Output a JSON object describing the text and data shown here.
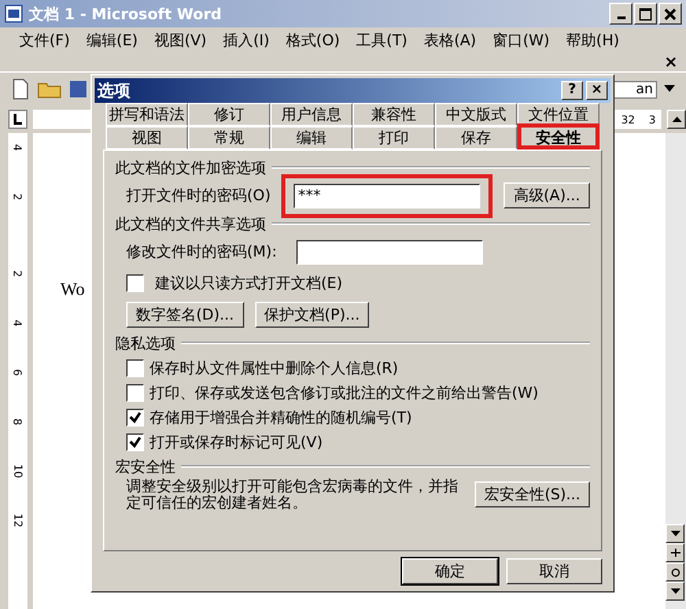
{
  "window": {
    "title": "文档 1 - Microsoft Word"
  },
  "menu": [
    "文件(F)",
    "编辑(E)",
    "视图(V)",
    "插入(I)",
    "格式(O)",
    "工具(T)",
    "表格(A)",
    "窗口(W)",
    "帮助(H)"
  ],
  "menu_close": "×",
  "toolbar": {
    "font_field": "an"
  },
  "ruler": [
    "32",
    "3"
  ],
  "vertical_ruler": [
    "4",
    "2",
    "2",
    "4",
    "6",
    "8",
    "10",
    "12"
  ],
  "document": {
    "text": "Wo"
  },
  "dialog": {
    "title": "选项",
    "help": "?",
    "close": "×",
    "tabs_back": [
      {
        "label": "拼写和语法",
        "selected": false
      },
      {
        "label": "修订",
        "selected": false
      },
      {
        "label": "用户信息",
        "selected": false
      },
      {
        "label": "兼容性",
        "selected": false
      },
      {
        "label": "中文版式",
        "selected": false
      },
      {
        "label": "文件位置",
        "selected": false
      }
    ],
    "tabs_front": [
      {
        "label": "视图",
        "selected": false,
        "highlighted": false
      },
      {
        "label": "常规",
        "selected": false,
        "highlighted": false
      },
      {
        "label": "编辑",
        "selected": false,
        "highlighted": false
      },
      {
        "label": "打印",
        "selected": false,
        "highlighted": false
      },
      {
        "label": "保存",
        "selected": false,
        "highlighted": false
      },
      {
        "label": "安全性",
        "selected": true,
        "highlighted": true
      }
    ],
    "encryption": {
      "heading": "此文档的文件加密选项",
      "label": "打开文件时的密码(O)",
      "value": "***",
      "highlighted": true,
      "button": "高级(A)..."
    },
    "sharing": {
      "heading": "此文档的文件共享选项",
      "label": "修改文件时的密码(M):",
      "checkbox": {
        "label": "建议以只读方式打开文档(E)",
        "checked": false
      },
      "buttons": [
        "数字签名(D)...",
        "保护文档(P)..."
      ]
    },
    "privacy": {
      "heading": "隐私选项",
      "options": [
        {
          "label": "保存时从文件属性中删除个人信息(R)",
          "checked": false
        },
        {
          "label": "打印、保存或发送包含修订或批注的文件之前给出警告(W)",
          "checked": false
        },
        {
          "label": "存储用于增强合并精确性的随机编号(T)",
          "checked": true
        },
        {
          "label": "打开或保存时标记可见(V)",
          "checked": true
        }
      ]
    },
    "macro": {
      "heading": "宏安全性",
      "text": "调整安全级别以打开可能包含宏病毒的文件，并指定可信任的宏创建者姓名。",
      "button": "宏安全性(S)..."
    },
    "buttons": [
      "确定",
      "取消"
    ]
  }
}
